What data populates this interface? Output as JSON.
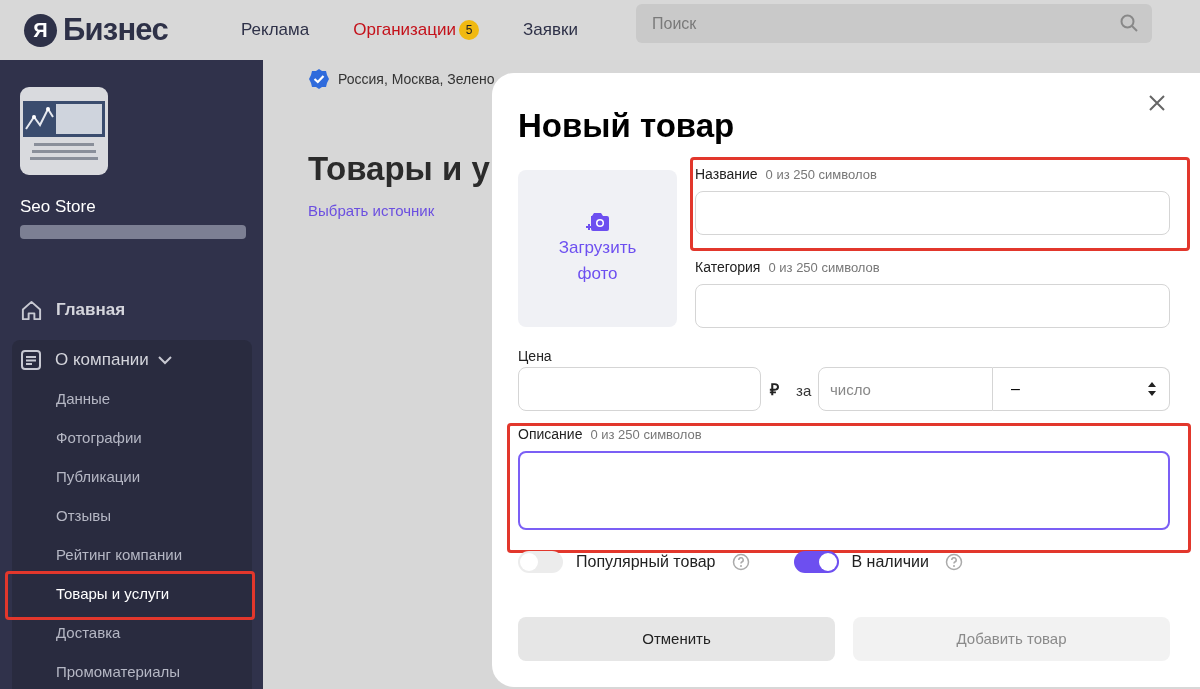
{
  "header": {
    "logo": {
      "mark": "Я",
      "text": "Бизнес"
    },
    "nav": [
      {
        "label": "Реклама",
        "selected": false
      },
      {
        "label": "Организации",
        "selected": true,
        "badge": "5"
      },
      {
        "label": "Заявки",
        "selected": false
      }
    ],
    "search": {
      "placeholder": "Поиск"
    }
  },
  "sidebar": {
    "company_name": "Seo Store",
    "address_redacted": true,
    "items": [
      {
        "label": "Главная",
        "kind": "home"
      },
      {
        "label": "О компании",
        "kind": "section",
        "expanded": true,
        "children": [
          {
            "label": "Данные",
            "selected": false,
            "highlighted": false
          },
          {
            "label": "Фотографии",
            "selected": false,
            "highlighted": false
          },
          {
            "label": "Публикации",
            "selected": false,
            "highlighted": false
          },
          {
            "label": "Отзывы",
            "selected": false,
            "highlighted": false
          },
          {
            "label": "Рейтинг компании",
            "selected": false,
            "highlighted": false
          },
          {
            "label": "Товары и услуги",
            "selected": true,
            "highlighted": true
          },
          {
            "label": "Доставка",
            "selected": false,
            "highlighted": false
          },
          {
            "label": "Промоматериалы",
            "selected": false,
            "highlighted": false
          }
        ]
      }
    ]
  },
  "page": {
    "address": "Россия, Москва, Зелено",
    "verified": true,
    "title": "Товары и у",
    "source_link": "Выбрать источник"
  },
  "modal": {
    "title": "Новый товар",
    "photo_button": "Загрузить фото",
    "name": {
      "label": "Название",
      "counter": "0 из 250 символов",
      "highlighted": true
    },
    "category": {
      "label": "Категория",
      "counter": "0 из 250 символов",
      "highlighted": false
    },
    "price": {
      "label": "Цена",
      "currency": "₽",
      "per": "за",
      "quantity_placeholder": "число",
      "unit": "–"
    },
    "description": {
      "label": "Описание",
      "counter": "0 из 250 символов",
      "highlighted": true,
      "focused": true
    },
    "toggles": [
      {
        "label": "Популярный товар",
        "on": false
      },
      {
        "label": "В наличии",
        "on": true
      }
    ],
    "buttons": [
      {
        "label": "Отменить",
        "disabled": false
      },
      {
        "label": "Добавить товар",
        "disabled": true
      }
    ]
  }
}
